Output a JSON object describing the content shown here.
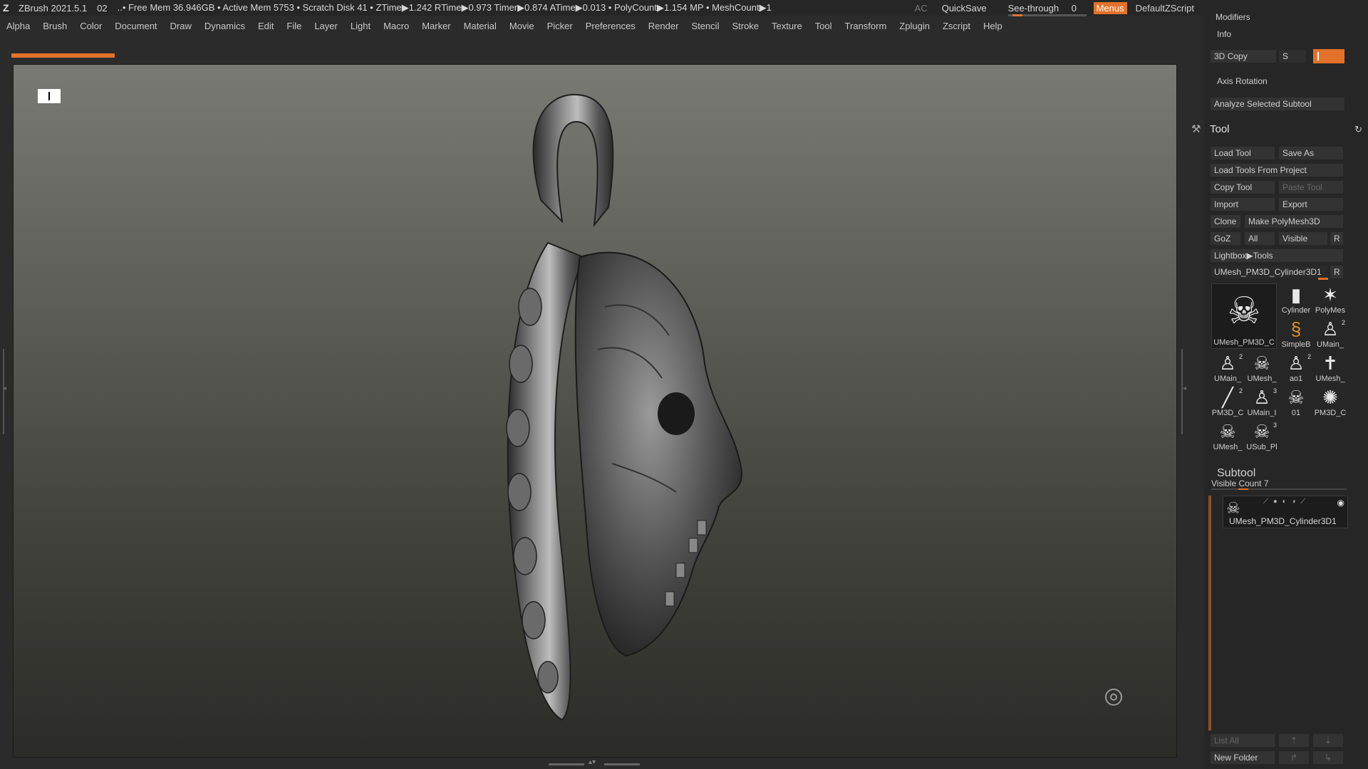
{
  "titlebar": {
    "app_title": "ZBrush 2021.5.1",
    "doc_number": "02",
    "status": "..• Free Mem 36.946GB • Active Mem 5753 • Scratch Disk 41 • ZTime▶1.242 RTime▶0.973 Timer▶0.874 ATime▶0.013 • PolyCount▶1.154 MP • MeshCount▶1",
    "ac_label": "AC",
    "quicksave_label": "QuickSave",
    "seethrough_label": "See-through",
    "seethrough_value": "0",
    "seethrough_fraction": 0,
    "menus_label": "Menus",
    "script_label": "DefaultZScript"
  },
  "menubar": {
    "items": [
      "Alpha",
      "Brush",
      "Color",
      "Document",
      "Draw",
      "Dynamics",
      "Edit",
      "File",
      "Layer",
      "Light",
      "Macro",
      "Marker",
      "Material",
      "Movie",
      "Picker",
      "Preferences",
      "Render",
      "Stencil",
      "Stroke",
      "Texture",
      "Tool",
      "Transform",
      "Zplugin",
      "Zscript",
      "Help"
    ]
  },
  "rpanel": {
    "modifiers_label": "Modifiers",
    "info_label": "Info",
    "copy3d_label": "3D Copy",
    "s_label": "S",
    "axis_rotation_label": "Axis Rotation",
    "analyze_label": "Analyze Selected Subtool",
    "tool": {
      "title": "Tool",
      "load_tool": "Load Tool",
      "save_as": "Save As",
      "load_from_project": "Load Tools From Project",
      "copy_tool": "Copy Tool",
      "paste_tool": "Paste Tool",
      "import": "Import",
      "export": "Export",
      "clone": "Clone",
      "make_polymesh": "Make PolyMesh3D",
      "goz": "GoZ",
      "all": "All",
      "visible": "Visible",
      "r": "R",
      "lightbox_tools": "Lightbox▶Tools",
      "current_tool": "UMesh_PM3D_Cylinder3D1",
      "big_thumb_label": "UMesh_PM3D_C",
      "thumbs": [
        {
          "label": "Cylinder",
          "icon": "cylinder-icon",
          "badge": ""
        },
        {
          "label": "PolyMes",
          "icon": "star-icon",
          "badge": ""
        },
        {
          "label": "SimpleB",
          "icon": "simplebrush-icon",
          "badge": ""
        },
        {
          "label": "UMain_",
          "icon": "figure-icon",
          "badge": "2"
        },
        {
          "label": "UMain_",
          "icon": "figure-icon",
          "badge": "2"
        },
        {
          "label": "UMesh_",
          "icon": "skull-icon",
          "badge": ""
        },
        {
          "label": "ao1",
          "icon": "figure-icon",
          "badge": "2"
        },
        {
          "label": "UMesh_",
          "icon": "cross-icon",
          "badge": ""
        },
        {
          "label": "PM3D_C",
          "icon": "stick-icon",
          "badge": "2"
        },
        {
          "label": "UMain_I",
          "icon": "figure-icon",
          "badge": "3"
        },
        {
          "label": "01",
          "icon": "skull-icon",
          "badge": ""
        },
        {
          "label": "PM3D_C",
          "icon": "gear-icon",
          "badge": ""
        },
        {
          "label": "UMesh_",
          "icon": "skull-icon",
          "badge": ""
        },
        {
          "label": "USub_Pl",
          "icon": "skull-icon",
          "badge": "3"
        }
      ]
    },
    "subtool": {
      "title": "Subtool",
      "visible_count": "Visible Count 7",
      "item_name": "UMesh_PM3D_Cylinder3D1",
      "list_all": "List All",
      "new_folder": "New Folder"
    }
  }
}
